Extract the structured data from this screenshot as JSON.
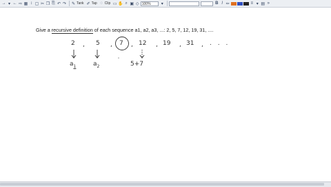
{
  "toolbar": {
    "buttons": [
      {
        "name": "select-icon",
        "glyph": "→"
      },
      {
        "name": "dropdown-icon",
        "glyph": "▾"
      },
      {
        "name": "back-icon",
        "glyph": "←"
      },
      {
        "name": "forward-icon",
        "glyph": "⇨"
      },
      {
        "name": "layout-icon",
        "glyph": "▦"
      },
      {
        "name": "insert-space-icon",
        "glyph": "↕"
      },
      {
        "name": "page-icon",
        "glyph": "▢"
      },
      {
        "name": "cut-icon",
        "glyph": "✂"
      },
      {
        "name": "copy-icon",
        "glyph": "❐"
      },
      {
        "name": "paste-icon",
        "glyph": "⎘"
      },
      {
        "name": "undo-icon",
        "glyph": "↶"
      },
      {
        "name": "redo-icon",
        "glyph": "↷"
      }
    ],
    "tank_label": "Tank",
    "tap_label": "Tap",
    "clip_label": "Clip",
    "zoom_value": "100%",
    "bold_label": "B",
    "italic_label": "I",
    "pen_colors": [
      "#e07020",
      "#3050c0",
      "#222222"
    ]
  },
  "content": {
    "question_prefix": "Give a ",
    "question_term": "recursive definition",
    "question_suffix": " of each sequence a1, a2, a3, ...: 2, 5, 7, 12, 19, 31, ....",
    "handwriting": {
      "terms": [
        "2",
        "5",
        "7",
        "12",
        "19",
        "31",
        ". . ."
      ],
      "a1": "a",
      "a1_sub": "1",
      "a2": "a",
      "a2_sub": "2",
      "sum": "5+7"
    }
  }
}
